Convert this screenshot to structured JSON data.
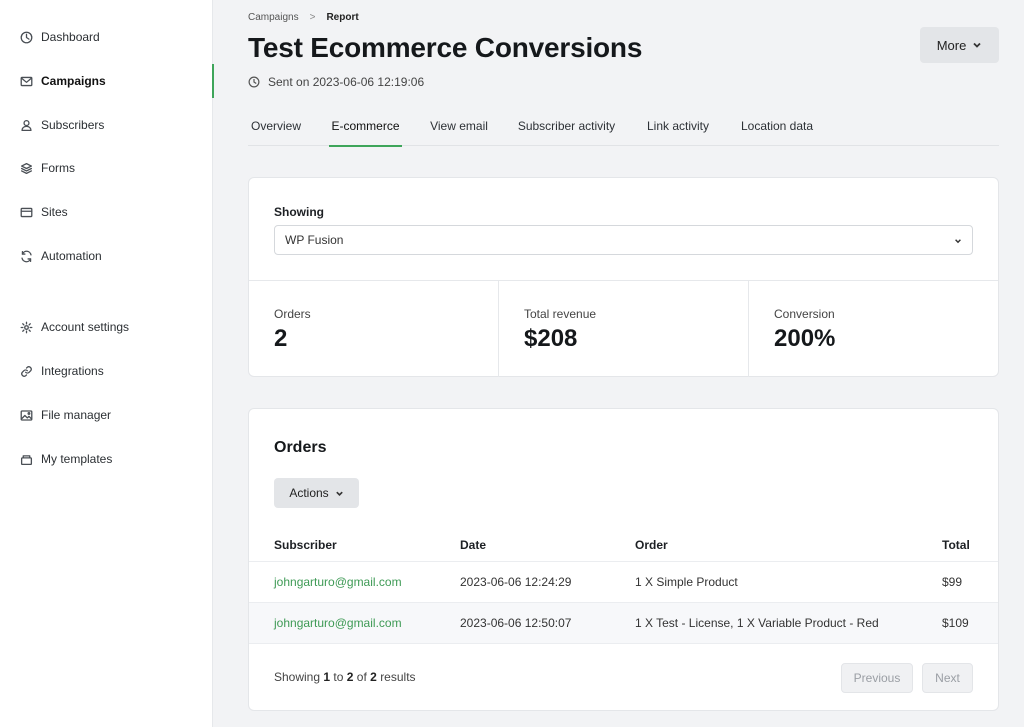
{
  "sidebar": {
    "items": [
      {
        "label": "Dashboard",
        "icon": "clock-icon"
      },
      {
        "label": "Campaigns",
        "icon": "mail-icon",
        "active": true
      },
      {
        "label": "Subscribers",
        "icon": "user-icon"
      },
      {
        "label": "Forms",
        "icon": "layers-icon"
      },
      {
        "label": "Sites",
        "icon": "browser-icon"
      },
      {
        "label": "Automation",
        "icon": "refresh-icon"
      },
      {
        "label": "Account settings",
        "icon": "gear-icon"
      },
      {
        "label": "Integrations",
        "icon": "link-icon"
      },
      {
        "label": "File manager",
        "icon": "image-icon"
      },
      {
        "label": "My templates",
        "icon": "template-icon"
      }
    ]
  },
  "breadcrumb": {
    "parent": "Campaigns",
    "separator": ">",
    "current": "Report"
  },
  "header": {
    "title": "Test Ecommerce Conversions",
    "sent": "Sent on 2023-06-06 12:19:06",
    "more_label": "More"
  },
  "tabs": [
    {
      "label": "Overview"
    },
    {
      "label": "E-commerce",
      "active": true
    },
    {
      "label": "View email"
    },
    {
      "label": "Subscriber activity"
    },
    {
      "label": "Link activity"
    },
    {
      "label": "Location data"
    }
  ],
  "filter": {
    "label": "Showing",
    "selected": "WP Fusion"
  },
  "stats": [
    {
      "label": "Orders",
      "value": "2"
    },
    {
      "label": "Total revenue",
      "value": "$208"
    },
    {
      "label": "Conversion",
      "value": "200%"
    }
  ],
  "orders": {
    "title": "Orders",
    "actions_label": "Actions",
    "columns": [
      "Subscriber",
      "Date",
      "Order",
      "Total"
    ],
    "rows": [
      {
        "subscriber": "johngarturo@gmail.com",
        "date": "2023-06-06 12:24:29",
        "order": "1 X Simple Product",
        "total": "$99"
      },
      {
        "subscriber": "johngarturo@gmail.com",
        "date": "2023-06-06 12:50:07",
        "order": "1 X Test - License, 1 X Variable Product - Red",
        "total": "$109"
      }
    ],
    "pagination": {
      "prefix": "Showing",
      "from": "1",
      "to_word": "to",
      "to": "2",
      "of_word": "of",
      "total": "2",
      "suffix": "results",
      "previous_label": "Previous",
      "next_label": "Next"
    }
  },
  "colors": {
    "accent": "#3ea55a",
    "link": "#3e9a55",
    "button_bg": "#e3e5e8"
  }
}
